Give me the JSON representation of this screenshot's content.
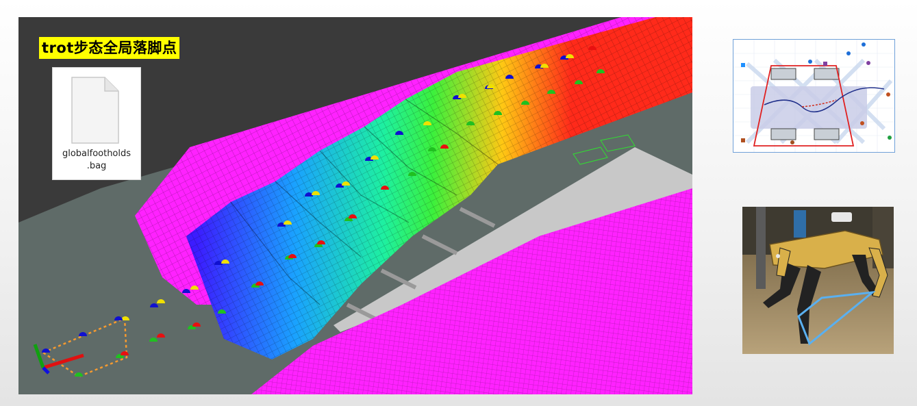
{
  "viewport": {
    "title": "trot步态全局落脚点"
  },
  "file": {
    "name_line1": "globalfootholds",
    "name_line2": ".bag",
    "icon": "document-icon"
  },
  "colors": {
    "background_dark": "#3a3a3a",
    "ground": "#5f6b68",
    "magenta": "#ff22ff",
    "gray_floor": "#c8c8c8",
    "steps": [
      "#3c1cff",
      "#1aa2ff",
      "#1ef0a0",
      "#3cf03c",
      "#ffc814",
      "#ff2a1a"
    ],
    "foot_blue": "#1010d0",
    "foot_yellow": "#f0e000",
    "foot_red": "#e81010",
    "foot_green": "#20c020",
    "support_polygon": "#f59a30",
    "title_highlight": "#ffff00",
    "diagram_border": "#6fa0d8",
    "robot_body": "#d9b04a",
    "robot_leg_polygon": "#5ab0f0"
  },
  "panels": {
    "gait_diagram": "trot-support-polygon-diagram",
    "robot_photo": "quadruped-robot-photo"
  }
}
